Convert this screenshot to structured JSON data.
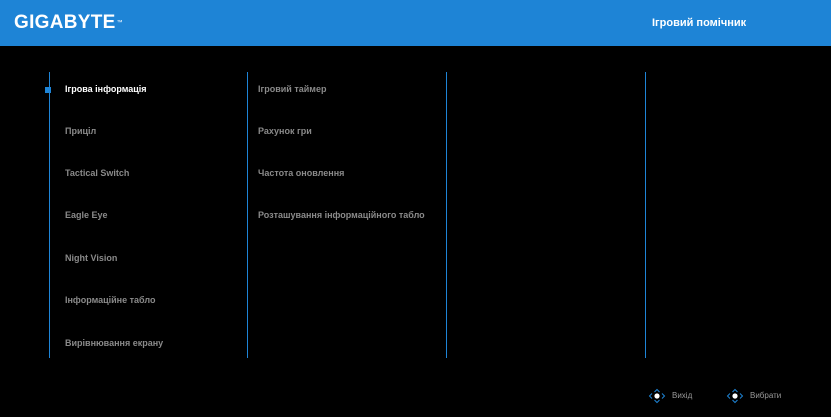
{
  "header": {
    "logo_text": "GIGABYTE",
    "logo_tm": "™",
    "title": "Ігровий помічник"
  },
  "main_menu": {
    "items": [
      {
        "label": "Ігрова інформація",
        "active": true
      },
      {
        "label": "Приціл",
        "active": false
      },
      {
        "label": "Tactical Switch",
        "active": false
      },
      {
        "label": "Eagle Eye",
        "active": false
      },
      {
        "label": "Night Vision",
        "active": false
      },
      {
        "label": "Інформаційне табло",
        "active": false
      },
      {
        "label": "Вирівнювання екрану",
        "active": false
      }
    ]
  },
  "submenu": {
    "items": [
      {
        "label": "Ігровий таймер"
      },
      {
        "label": "Рахунок гри"
      },
      {
        "label": "Частота оновлення"
      },
      {
        "label": "Розташування інформаційного табло"
      }
    ]
  },
  "footer": {
    "exit_label": "Вихід",
    "select_label": "Вибрати",
    "exit_icon": "joystick-icon",
    "select_icon": "joystick-icon"
  },
  "colors": {
    "accent": "#1e84d6",
    "background": "#000000",
    "active_text": "#ffffff",
    "inactive_text": "#8a8a8a"
  }
}
